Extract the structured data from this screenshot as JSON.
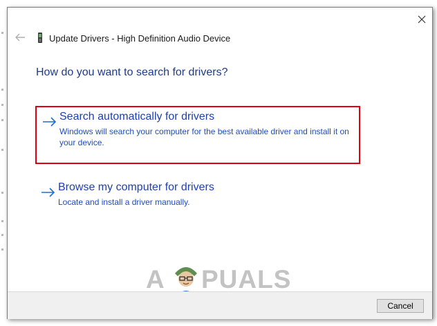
{
  "dialog": {
    "title": "Update Drivers - High Definition Audio Device",
    "heading": "How do you want to search for drivers?"
  },
  "options": [
    {
      "title": "Search automatically for drivers",
      "description": "Windows will search your computer for the best available driver and install it on your device."
    },
    {
      "title": "Browse my computer for drivers",
      "description": "Locate and install a driver manually."
    }
  ],
  "footer": {
    "cancel_label": "Cancel"
  },
  "watermark": {
    "left": "A",
    "right": "PUALS"
  },
  "colors": {
    "heading": "#1e3a8a",
    "link": "#1e40af",
    "highlight_border": "#e0000f",
    "footer_bg": "#f0f0f0"
  },
  "icons": {
    "close": "close-icon",
    "back": "back-arrow-icon",
    "device": "audio-device-icon",
    "option_arrow": "right-arrow-icon"
  }
}
